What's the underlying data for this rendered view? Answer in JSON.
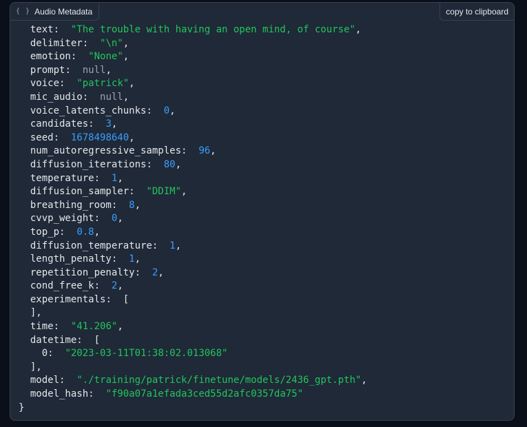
{
  "panel": {
    "label": "Audio Metadata",
    "copy_label": "copy to clipboard"
  },
  "metadata": [
    {
      "indent": 1,
      "key": "text",
      "value": "\"The trouble with having an open mind, of course\"",
      "type": "string",
      "comma": true
    },
    {
      "indent": 1,
      "key": "delimiter",
      "value": "\"\\n\"",
      "type": "string",
      "comma": true
    },
    {
      "indent": 1,
      "key": "emotion",
      "value": "\"None\"",
      "type": "string",
      "comma": true
    },
    {
      "indent": 1,
      "key": "prompt",
      "value": "null",
      "type": "null",
      "comma": true
    },
    {
      "indent": 1,
      "key": "voice",
      "value": "\"patrick\"",
      "type": "string",
      "comma": true
    },
    {
      "indent": 1,
      "key": "mic_audio",
      "value": "null",
      "type": "null",
      "comma": true
    },
    {
      "indent": 1,
      "key": "voice_latents_chunks",
      "value": "0",
      "type": "number",
      "comma": true
    },
    {
      "indent": 1,
      "key": "candidates",
      "value": "3",
      "type": "number",
      "comma": true
    },
    {
      "indent": 1,
      "key": "seed",
      "value": "1678498640",
      "type": "number",
      "comma": true
    },
    {
      "indent": 1,
      "key": "num_autoregressive_samples",
      "value": "96",
      "type": "number",
      "comma": true
    },
    {
      "indent": 1,
      "key": "diffusion_iterations",
      "value": "80",
      "type": "number",
      "comma": true
    },
    {
      "indent": 1,
      "key": "temperature",
      "value": "1",
      "type": "number",
      "comma": true
    },
    {
      "indent": 1,
      "key": "diffusion_sampler",
      "value": "\"DDIM\"",
      "type": "string",
      "comma": true
    },
    {
      "indent": 1,
      "key": "breathing_room",
      "value": "8",
      "type": "number",
      "comma": true
    },
    {
      "indent": 1,
      "key": "cvvp_weight",
      "value": "0",
      "type": "number",
      "comma": true
    },
    {
      "indent": 1,
      "key": "top_p",
      "value": "0.8",
      "type": "number",
      "comma": true
    },
    {
      "indent": 1,
      "key": "diffusion_temperature",
      "value": "1",
      "type": "number",
      "comma": true
    },
    {
      "indent": 1,
      "key": "length_penalty",
      "value": "1",
      "type": "number",
      "comma": true
    },
    {
      "indent": 1,
      "key": "repetition_penalty",
      "value": "2",
      "type": "number",
      "comma": true
    },
    {
      "indent": 1,
      "key": "cond_free_k",
      "value": "2",
      "type": "number",
      "comma": true
    },
    {
      "indent": 1,
      "key": "experimentals",
      "value": "[",
      "type": "punct",
      "comma": false
    },
    {
      "indent": 1,
      "key": "",
      "value": "],",
      "type": "punct",
      "comma": false
    },
    {
      "indent": 1,
      "key": "time",
      "value": "\"41.206\"",
      "type": "string",
      "comma": true
    },
    {
      "indent": 1,
      "key": "datetime",
      "value": "[",
      "type": "punct",
      "comma": false
    },
    {
      "indent": 2,
      "key": "0",
      "value": "\"2023-03-11T01:38:02.013068\"",
      "type": "string",
      "comma": false
    },
    {
      "indent": 1,
      "key": "",
      "value": "],",
      "type": "punct",
      "comma": false
    },
    {
      "indent": 1,
      "key": "model",
      "value": "\"./training/patrick/finetune/models/2436_gpt.pth\"",
      "type": "string",
      "comma": true
    },
    {
      "indent": 1,
      "key": "model_hash",
      "value": "\"f90a07a1efada3ced55d2afc0357da75\"",
      "type": "string",
      "comma": false
    },
    {
      "indent": 0,
      "key": "",
      "value": "}",
      "type": "punct",
      "comma": false
    }
  ]
}
